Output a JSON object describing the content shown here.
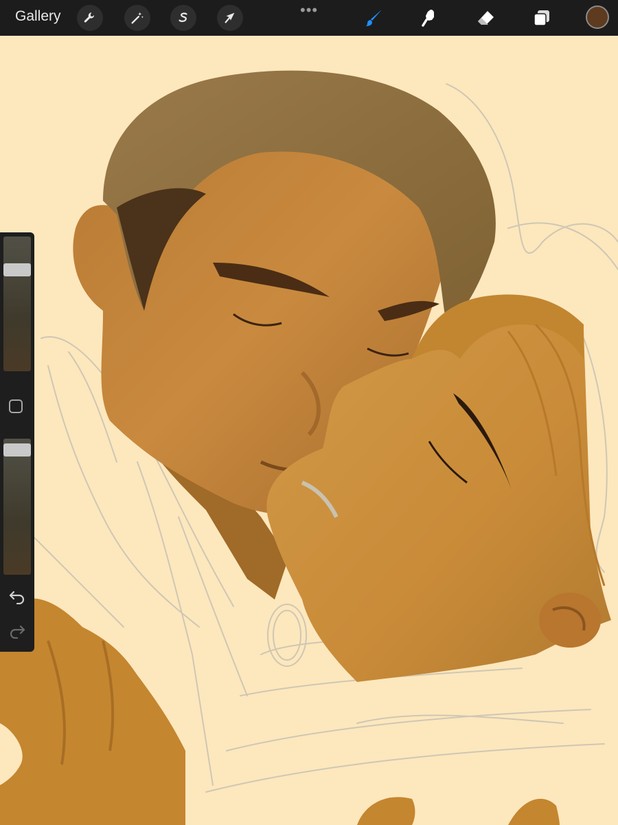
{
  "toolbar": {
    "gallery_label": "Gallery",
    "left_tools": [
      {
        "name": "actions",
        "icon": "wrench-icon"
      },
      {
        "name": "adjustments",
        "icon": "magic-wand-icon"
      },
      {
        "name": "selection",
        "icon": "selection-s-icon"
      },
      {
        "name": "transform",
        "icon": "arrow-cursor-icon"
      }
    ],
    "more_icon": "•••",
    "right_tools": [
      {
        "name": "brush",
        "icon": "brush-icon",
        "active": true
      },
      {
        "name": "smudge",
        "icon": "smudge-icon",
        "active": false
      },
      {
        "name": "eraser",
        "icon": "eraser-icon",
        "active": false
      },
      {
        "name": "layers",
        "icon": "layers-icon",
        "active": false
      }
    ],
    "current_color": "#5e3a1e",
    "active_color": "#1f8fff"
  },
  "sidebar": {
    "brush_size_level": 0.78,
    "opacity_level": 0.96,
    "modifier_button": "square-icon",
    "undo_icon": "undo-arrow-icon",
    "redo_icon": "redo-arrow-icon"
  },
  "canvas": {
    "background_color": "#fde7bd",
    "skin_color": "#c78a3c",
    "hair_color": "#8a6a3a",
    "sketch_color": "#cfc7b3"
  }
}
